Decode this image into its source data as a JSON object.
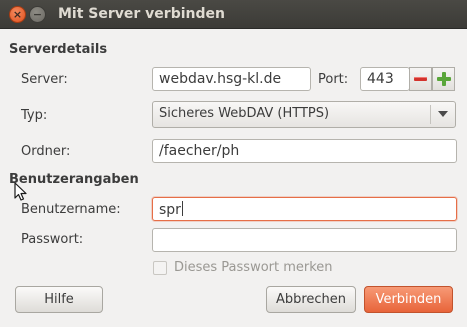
{
  "window": {
    "title": "Mit Server verbinden",
    "close_glyph": "×",
    "minimize_glyph": "−"
  },
  "server_details": {
    "heading": "Serverdetails",
    "server_label": "Server:",
    "server_value": "webdav.hsg-kl.de",
    "port_label": "Port:",
    "port_value": "443",
    "type_label": "Typ:",
    "type_value": "Sicheres WebDAV (HTTPS)",
    "folder_label": "Ordner:",
    "folder_value": "/faecher/ph"
  },
  "user_details": {
    "heading": "Benutzerangaben",
    "username_label": "Benutzername:",
    "username_value": "spr",
    "password_label": "Passwort:",
    "password_value": "",
    "remember_label": "Dieses Passwort merken",
    "remember_checked": false
  },
  "buttons": {
    "help": "Hilfe",
    "cancel": "Abbrechen",
    "connect": "Verbinden"
  },
  "icons": {
    "close": "close-icon",
    "minimize": "minimize-icon",
    "port_decrement": "minus-icon",
    "port_increment": "plus-icon",
    "dropdown": "chevron-down-icon",
    "pointer": "mouse-pointer-icon"
  },
  "colors": {
    "accent": "#e66e47",
    "titlebar": "#3c3b37",
    "background": "#f2f1f0"
  }
}
